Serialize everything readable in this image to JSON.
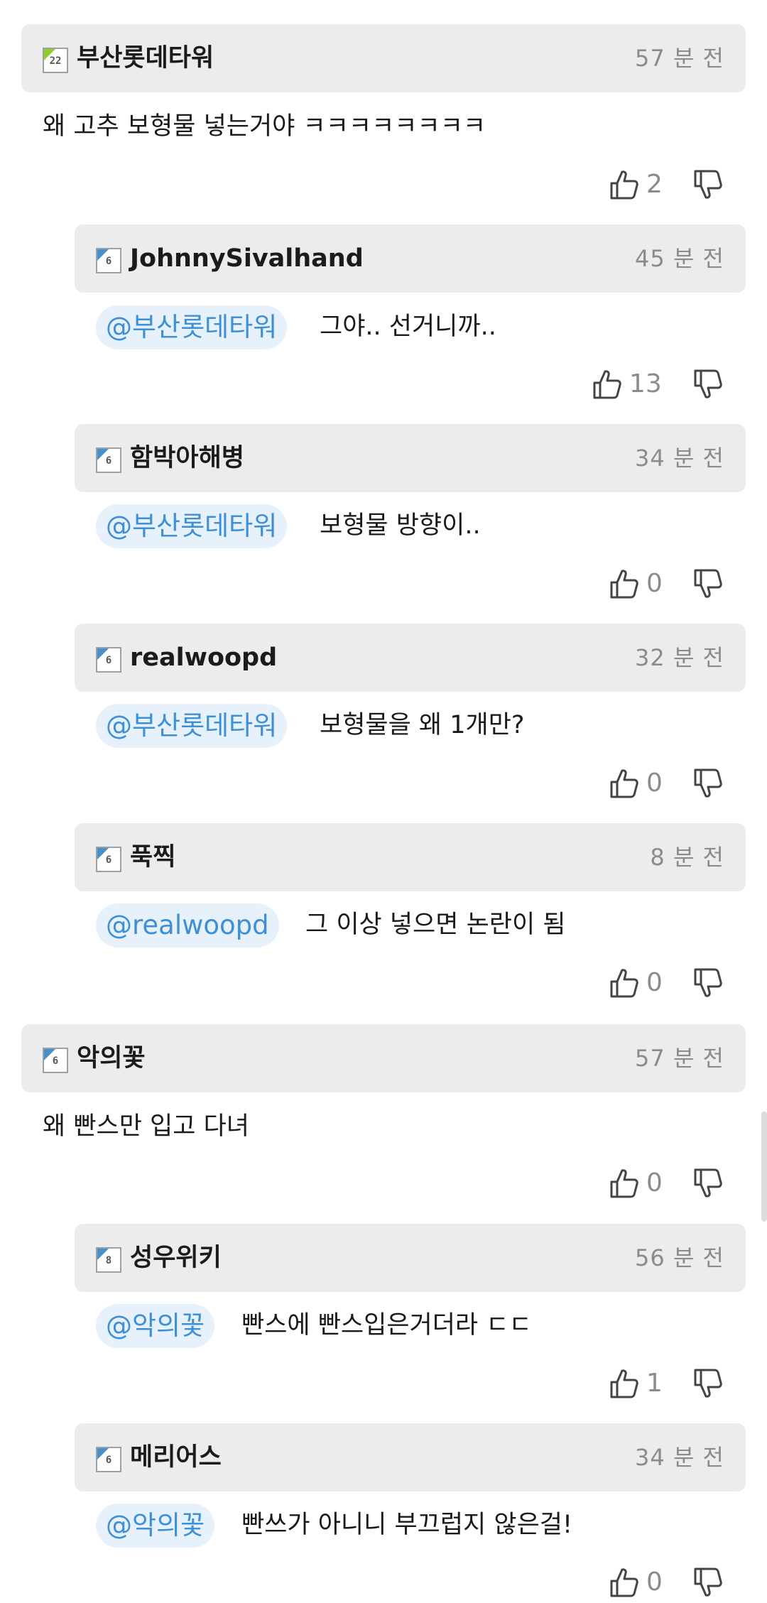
{
  "colors": {
    "header_bg": "#ececec",
    "mention_bg": "#e6f1fb",
    "mention_text": "#3d8fd6",
    "muted_text": "#8b8b8b"
  },
  "icons": {
    "level": "level-badge-icon",
    "like": "thumbs-up-icon",
    "dislike": "thumbs-down-icon"
  },
  "comments": [
    {
      "username": "부산롯데타워",
      "time": "57 분 전",
      "level": "22",
      "text": "왜 고추 보형물 넣는거야 ㅋㅋㅋㅋㅋㅋㅋㅋ",
      "likes": "2",
      "replies": [
        {
          "username": "JohnnySivalhand",
          "time": "45 분 전",
          "level": "6",
          "mention": "@부산롯데타워",
          "text": "그야.. 선거니까..",
          "likes": "13"
        },
        {
          "username": "함박아해병",
          "time": "34 분 전",
          "level": "6",
          "mention": "@부산롯데타워",
          "text": "보형물 방향이..",
          "likes": "0"
        },
        {
          "username": "realwoopd",
          "time": "32 분 전",
          "level": "6",
          "mention": "@부산롯데타워",
          "text": "보형물을 왜 1개만?",
          "likes": "0"
        },
        {
          "username": "푹찍",
          "time": "8 분 전",
          "level": "6",
          "mention": "@realwoopd",
          "text": "그 이상 넣으면 논란이 됨",
          "likes": "0"
        }
      ]
    },
    {
      "username": "악의꽃",
      "time": "57 분 전",
      "level": "6",
      "text": "왜 빤스만 입고 다녀",
      "likes": "0",
      "replies": [
        {
          "username": "성우위키",
          "time": "56 분 전",
          "level": "8",
          "mention": "@악의꽃",
          "text": "빤스에 빤스입은거더라 ㄷㄷ",
          "likes": "1"
        },
        {
          "username": "메리어스",
          "time": "34 분 전",
          "level": "6",
          "mention": "@악의꽃",
          "text": "빤쓰가 아니니 부끄럽지 않은걸!",
          "likes": "0"
        }
      ]
    }
  ]
}
